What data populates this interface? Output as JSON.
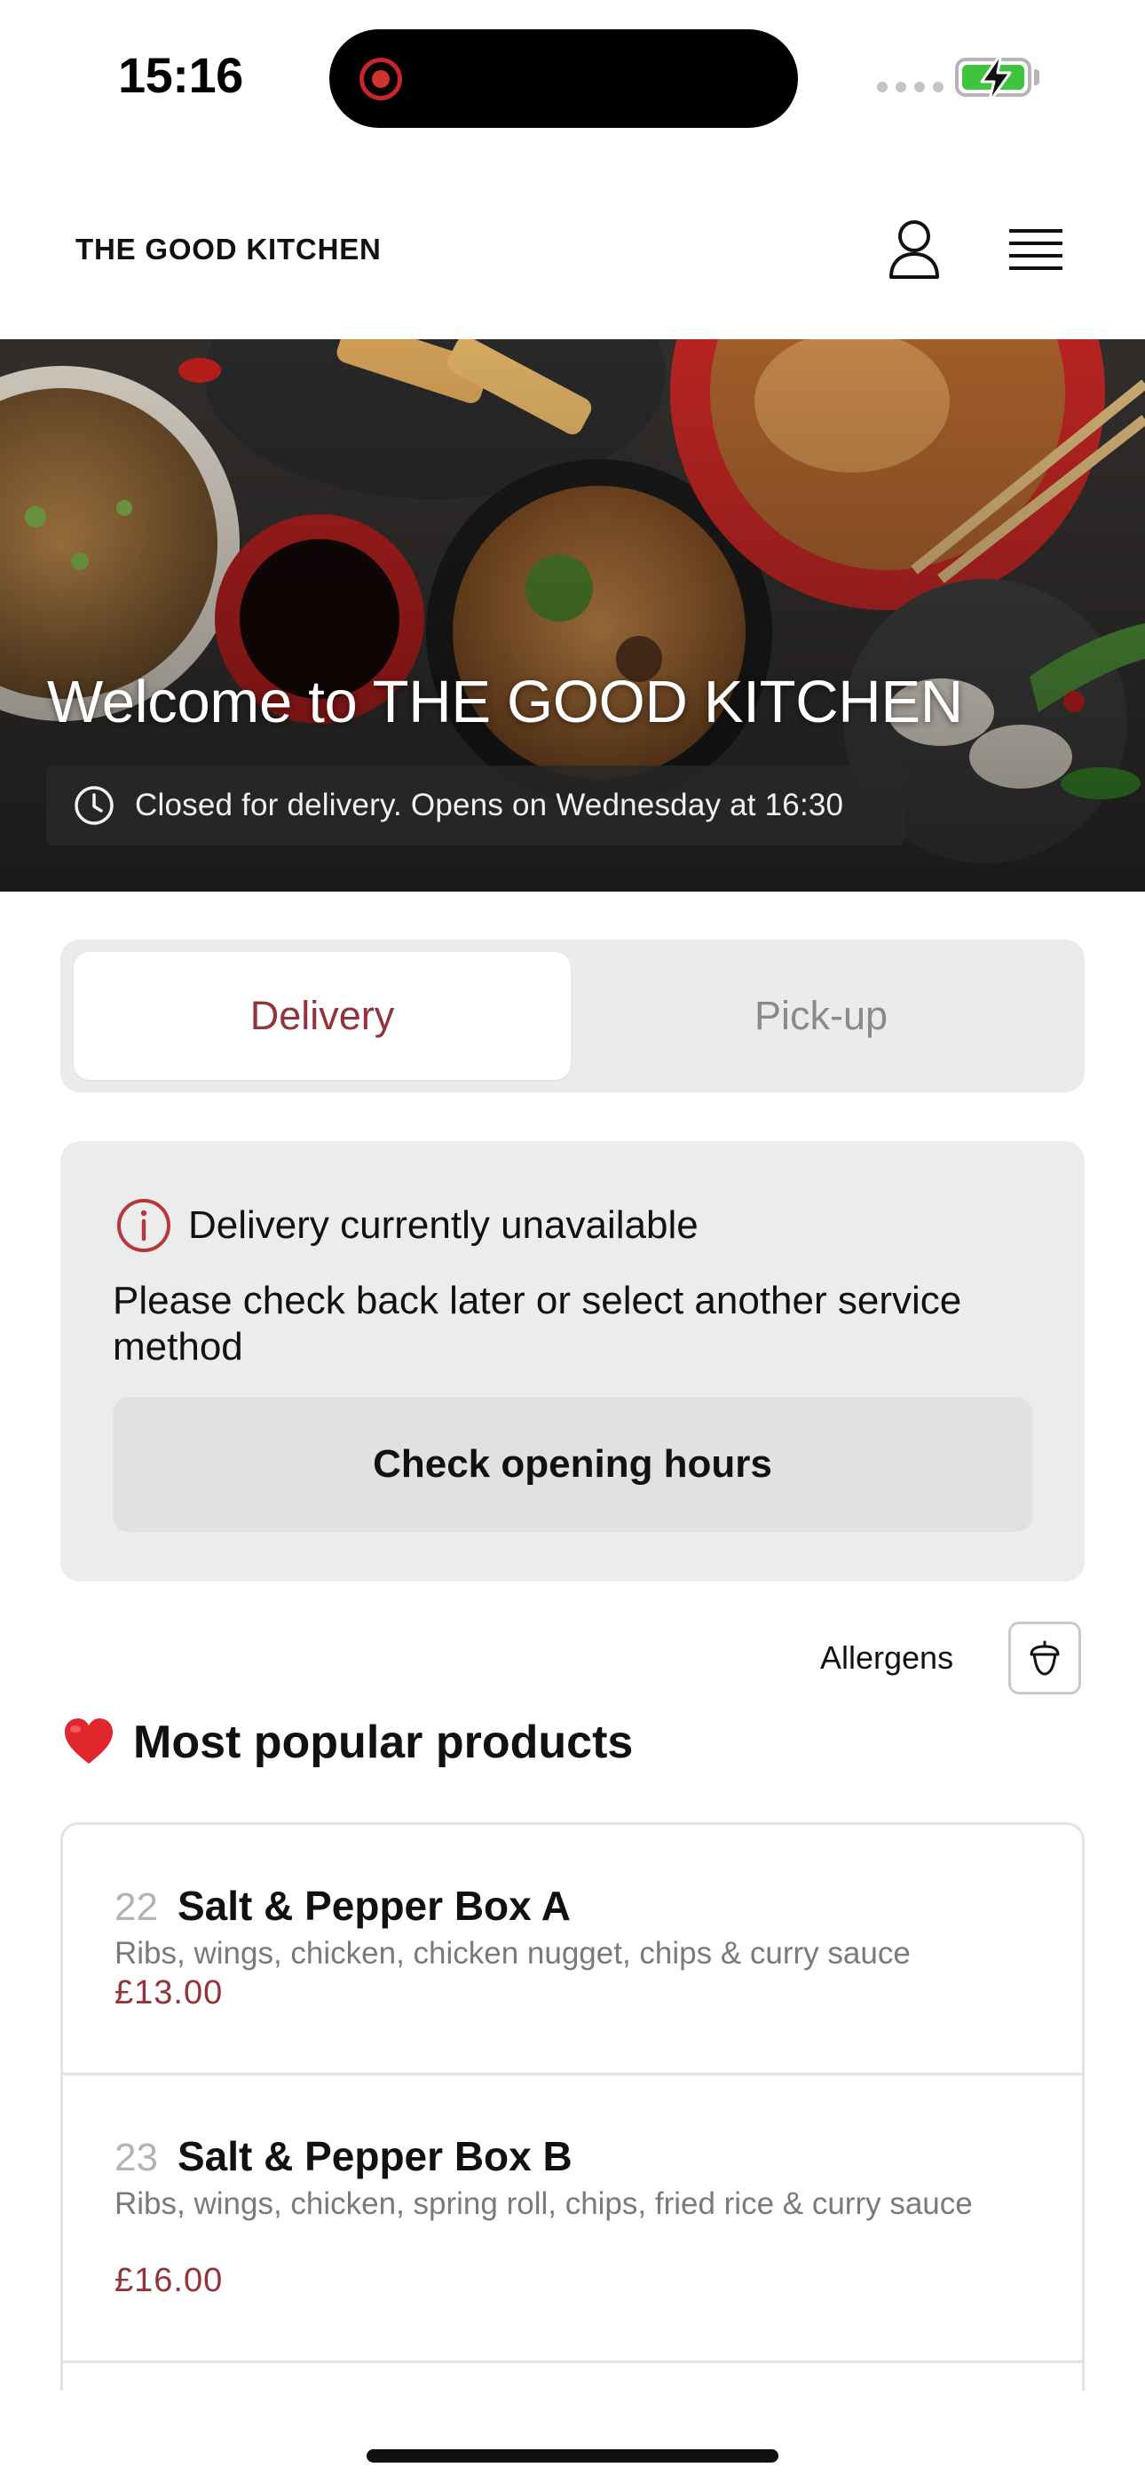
{
  "status_bar": {
    "time": "15:16"
  },
  "header": {
    "brand": "THE GOOD KITCHEN",
    "icons": [
      "user-icon",
      "menu-icon"
    ]
  },
  "hero": {
    "title": "Welcome to THE GOOD KITCHEN",
    "status": "Closed for delivery. Opens on Wednesday at 16:30"
  },
  "service_toggle": {
    "options": [
      "Delivery",
      "Pick-up"
    ],
    "selected": "Delivery"
  },
  "notice": {
    "title": "Delivery currently unavailable",
    "body": "Please check back later or select another service method",
    "button": "Check opening hours"
  },
  "allergens": {
    "label": "Allergens",
    "icon": "acorn-icon"
  },
  "popular": {
    "title": "Most popular products",
    "icon": "heart-icon",
    "products": [
      {
        "number": "22",
        "name": "Salt & Pepper Box A",
        "description": "Ribs, wings, chicken, chicken nugget, chips & curry sauce",
        "price": "£13.00"
      },
      {
        "number": "23",
        "name": "Salt & Pepper Box B",
        "description": "Ribs, wings, chicken, spring roll, chips, fried rice & curry sauce",
        "price": "£16.00"
      }
    ]
  },
  "colors": {
    "accent": "#93333b",
    "battery": "#3ec43f",
    "card_bg": "#ececec"
  }
}
